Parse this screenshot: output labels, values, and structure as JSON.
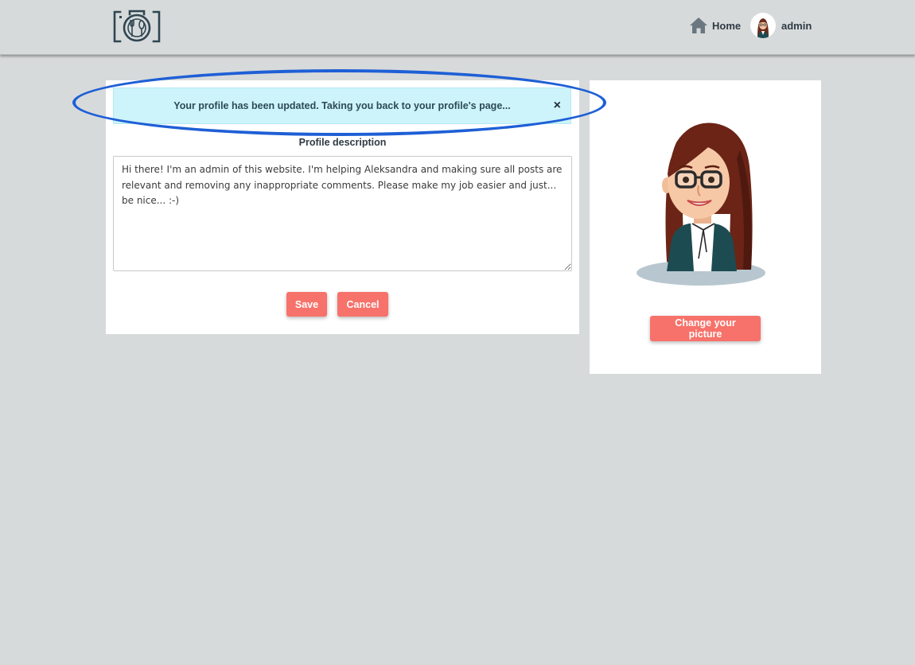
{
  "header": {
    "logo_icon": "camera-food-logo-icon",
    "home_label": "Home",
    "home_icon": "house-icon",
    "user_name": "admin"
  },
  "alert": {
    "message": "Your profile has been updated. Taking you back to your profile's page...",
    "close_label": "×"
  },
  "profile": {
    "description_label": "Profile description",
    "description_value": "Hi there! I'm an admin of this website. I'm helping Aleksandra and making sure all posts are relevant and removing any inappropriate comments. Please make my job easier and just... be nice... :-)",
    "save_label": "Save",
    "cancel_label": "Cancel",
    "change_picture_label": "Change your picture"
  },
  "colors": {
    "accent_button": "#f7726a",
    "alert_background": "#cdf4fb",
    "page_background": "#d7dadb",
    "annotation_outline": "#1e5fd6"
  }
}
